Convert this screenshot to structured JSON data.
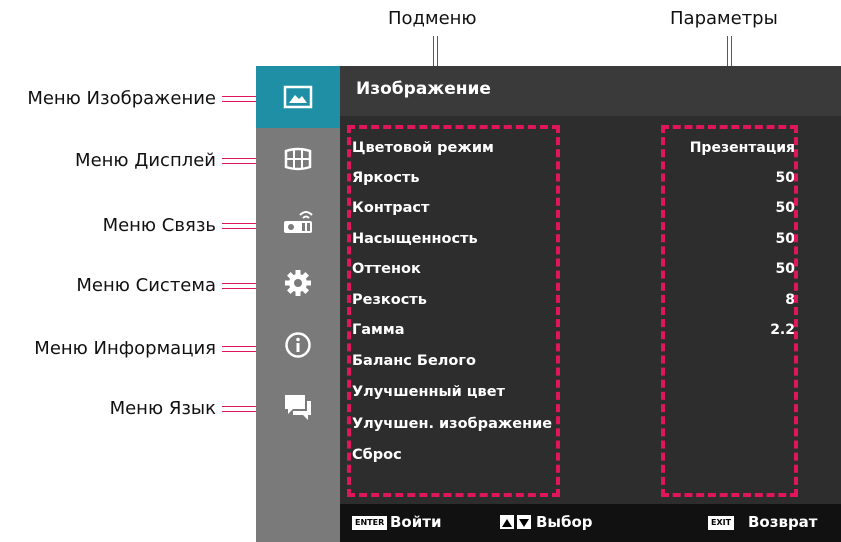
{
  "callouts": {
    "submenu": "Подменю",
    "parameters": "Параметры"
  },
  "side_labels": [
    "Меню Изображение",
    "Меню Дисплей",
    "Меню Связь",
    "Меню Система",
    "Меню Информация",
    "Меню Язык"
  ],
  "sidebar": {
    "icons": [
      "image-icon",
      "display-grid-icon",
      "connection-icon",
      "gear-icon",
      "info-icon",
      "language-chat-icon"
    ],
    "active_index": 0,
    "active_color": "#1e8fa5"
  },
  "header": {
    "title": "Изображение"
  },
  "menu_items": [
    "Цветовой режим",
    "Яркость",
    "Контраст",
    "Насыщенность",
    "Оттенок",
    "Резкость",
    "Гамма",
    "Баланс Белого",
    "Улучшенный цвет",
    "Улучшен. изображение",
    "Сброс"
  ],
  "param_values": [
    "Презентация",
    "50",
    "50",
    "50",
    "50",
    "8",
    "2.2"
  ],
  "footer": {
    "enter_key": "ENTER",
    "enter_label": "Войти",
    "select_label": "Выбор",
    "exit_key": "EXIT",
    "exit_label": "Возврат"
  },
  "colors": {
    "accent": "#e0165c",
    "osd_bg": "#2d2d2d",
    "sidebar_bg": "#7a7a7a"
  }
}
